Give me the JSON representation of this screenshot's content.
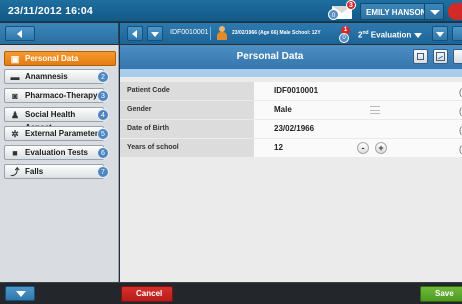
{
  "topbar": {
    "datetime": "23/11/2012 16:04",
    "messages_badge": "3",
    "messages_count": "0",
    "username": "EMILY HANSON"
  },
  "patient_bar": {
    "patient_id": "IDF0010001",
    "patient_info": "23/02/1966 (Age 66) Male School: 12Y",
    "eval_badge_red": "1",
    "eval_badge_blue": "0",
    "evaluation_number": "2",
    "evaluation_suffix": "nd",
    "evaluation_label": " Evaluation"
  },
  "sidebar": {
    "items": [
      {
        "label": "Personal Data",
        "icon": "id-card-icon"
      },
      {
        "label": "Anamnesis",
        "icon": "bed-icon",
        "num": "2"
      },
      {
        "label": "Pharmaco-Therapy",
        "icon": "pill-icon",
        "num": "3"
      },
      {
        "label": "Social Health Aspect",
        "icon": "people-icon",
        "num": "4"
      },
      {
        "label": "External Parameters",
        "icon": "gears-icon",
        "num": "5"
      },
      {
        "label": "Evaluation Tests",
        "icon": "book-icon",
        "num": "6"
      },
      {
        "label": "Falls",
        "icon": "falling-person-icon",
        "num": "7"
      }
    ]
  },
  "main": {
    "title": "Personal Data",
    "fields": [
      {
        "label": "Patient Code",
        "value": "IDF0010001"
      },
      {
        "label": "Gender",
        "value": "Male"
      },
      {
        "label": "Date of Birth",
        "value": "23/02/1966"
      },
      {
        "label": "Years of school",
        "value": "12"
      }
    ],
    "stepper_minus": "-",
    "stepper_plus": "+"
  },
  "bottombar": {
    "cancel_label": "Cancel",
    "save_label": "Save"
  },
  "colors": {
    "accent": "#1e6fa0",
    "active_tab": "#f08a1f",
    "cancel": "#c62826",
    "save": "#5aa92c"
  }
}
